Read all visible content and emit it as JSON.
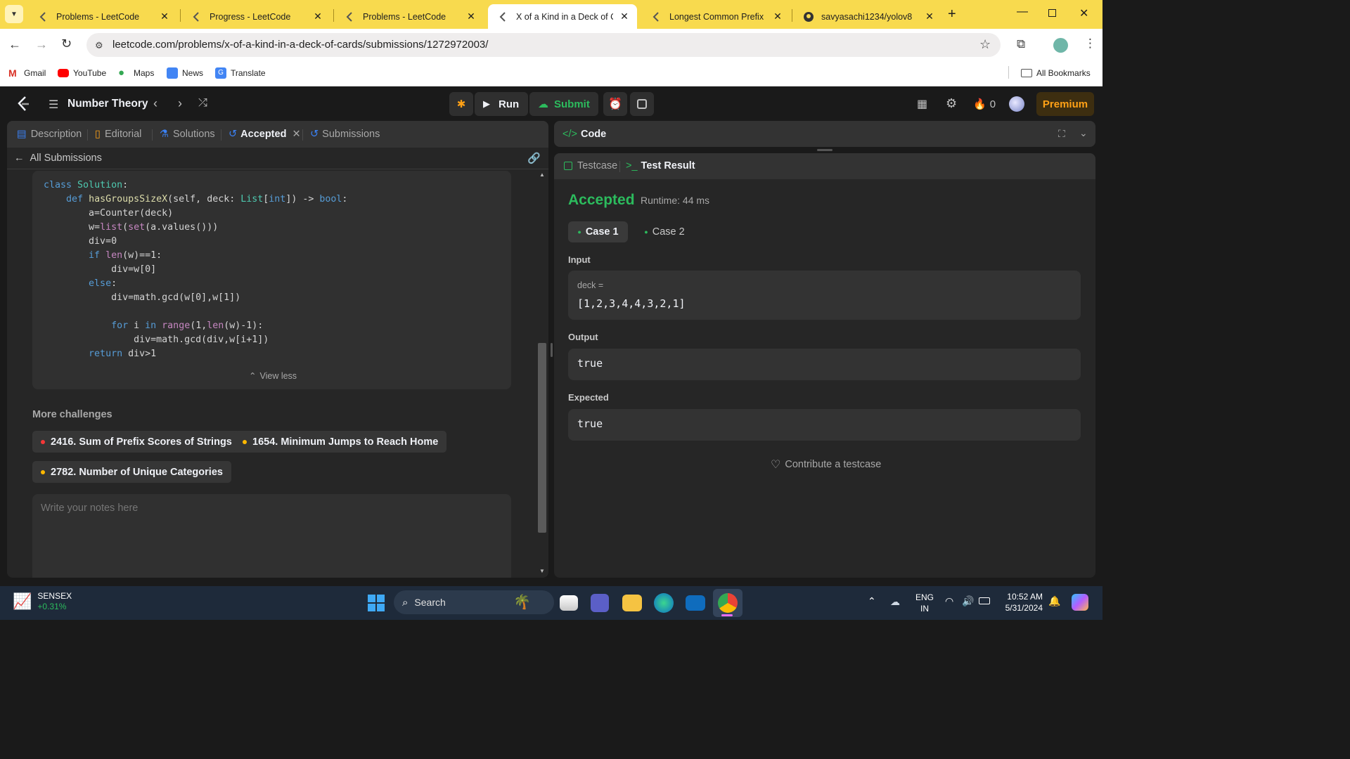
{
  "browser": {
    "tabs": [
      {
        "title": "Problems - LeetCode"
      },
      {
        "title": "Progress - LeetCode"
      },
      {
        "title": "Problems - LeetCode"
      },
      {
        "title": "X of a Kind in a Deck of Ca"
      },
      {
        "title": "Longest Common Prefix - L"
      },
      {
        "title": "savyasachi1234/yolov8"
      }
    ],
    "url": "leetcode.com/problems/x-of-a-kind-in-a-deck-of-cards/submissions/1272972003/",
    "bookmarks": [
      "Gmail",
      "YouTube",
      "Maps",
      "News",
      "Translate"
    ],
    "all_bookmarks": "All Bookmarks"
  },
  "lc": {
    "list_title": "Number Theory",
    "run": "Run",
    "submit": "Submit",
    "streak": "0",
    "premium": "Premium",
    "left_tabs": [
      "Description",
      "Editorial",
      "Solutions",
      "Accepted",
      "Submissions"
    ],
    "back_label": "All Submissions",
    "code_lines": [
      "class Solution:",
      "    def hasGroupsSizeX(self, deck: List[int]) -> bool:",
      "        a=Counter(deck)",
      "        w=list(set(a.values()))",
      "        div=0",
      "        if len(w)==1:",
      "            div=w[0]",
      "        else:",
      "            div=math.gcd(w[0],w[1])",
      "",
      "            for i in range(1,len(w)-1):",
      "                div=math.gcd(div,w[i+1])",
      "        return div>1"
    ],
    "view_less": "View less",
    "more_challenges": "More challenges",
    "challenges": [
      {
        "label": "2416. Sum of Prefix Scores of Strings",
        "color": "#f63737"
      },
      {
        "label": "1654. Minimum Jumps to Reach Home",
        "color": "#ffb800"
      },
      {
        "label": "2782. Number of Unique Categories",
        "color": "#ffb800"
      }
    ],
    "notes_placeholder": "Write your notes here",
    "code_title": "Code",
    "testcase_tab": "Testcase",
    "result_tab": "Test Result",
    "status": "Accepted",
    "runtime": "Runtime: 44 ms",
    "cases": [
      "Case 1",
      "Case 2"
    ],
    "input_label": "Input",
    "input_var": "deck =",
    "input_value": "[1,2,3,4,4,3,2,1]",
    "output_label": "Output",
    "output_value": "true",
    "expected_label": "Expected",
    "expected_value": "true",
    "contribute": "Contribute a testcase",
    "accent_green": "#2cbb5d",
    "accent_orange": "#ffa116"
  },
  "taskbar": {
    "ticker_name": "SENSEX",
    "ticker_change": "+0.31%",
    "search": "Search",
    "lang_1": "ENG",
    "lang_2": "IN",
    "time": "10:52 AM",
    "date": "5/31/2024"
  }
}
